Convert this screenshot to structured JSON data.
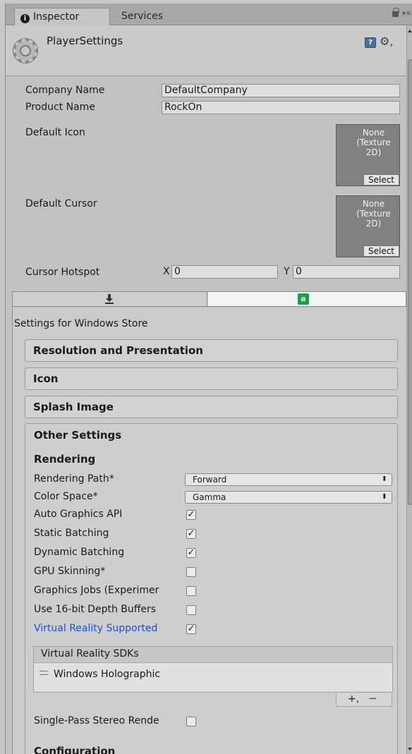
{
  "tabs": {
    "inspector_icon": "info-icon",
    "inspector": "Inspector",
    "services": "Services"
  },
  "header": {
    "title": "PlayerSettings"
  },
  "fields": {
    "company_name_label": "Company Name",
    "company_name_value": "DefaultCompany",
    "product_name_label": "Product Name",
    "product_name_value": "RockOn",
    "default_icon_label": "Default Icon",
    "default_cursor_label": "Default Cursor",
    "texture_none": "None",
    "texture_type": "(Texture 2D)",
    "texture_select": "Select",
    "cursor_hotspot_label": "Cursor Hotspot",
    "hotspot_x_label": "X",
    "hotspot_x_value": "0",
    "hotspot_y_label": "Y",
    "hotspot_y_value": "0"
  },
  "platform": {
    "active": "windows-store",
    "store_glyph": "a",
    "settings_title": "Settings for Windows Store"
  },
  "sections": {
    "resolution": "Resolution and Presentation",
    "icon": "Icon",
    "splash": "Splash Image",
    "other": "Other Settings"
  },
  "other_settings": {
    "rendering_header": "Rendering",
    "rendering_path_label": "Rendering Path*",
    "rendering_path_value": "Forward",
    "color_space_label": "Color Space*",
    "color_space_value": "Gamma",
    "auto_graphics_api_label": "Auto Graphics API",
    "auto_graphics_api_checked": true,
    "static_batching_label": "Static Batching",
    "static_batching_checked": true,
    "dynamic_batching_label": "Dynamic Batching",
    "dynamic_batching_checked": true,
    "gpu_skinning_label": "GPU Skinning*",
    "gpu_skinning_checked": false,
    "graphics_jobs_label": "Graphics Jobs (Experimer",
    "graphics_jobs_checked": false,
    "depth_16bit_label": "Use 16-bit Depth Buffers",
    "depth_16bit_checked": false,
    "vr_supported_label": "Virtual Reality Supported",
    "vr_supported_checked": true,
    "vr_sdks_header": "Virtual Reality SDKs",
    "vr_sdk_items": [
      "Windows Holographic"
    ],
    "add_sdk": "+,",
    "remove_sdk": "−",
    "single_pass_label": "Single-Pass Stereo Rende",
    "single_pass_checked": false,
    "configuration_header": "Configuration"
  },
  "colors": {
    "link_blue": "#1b4fd8",
    "store_green": "#16a13d",
    "panel_bg": "#c2c2c2"
  }
}
